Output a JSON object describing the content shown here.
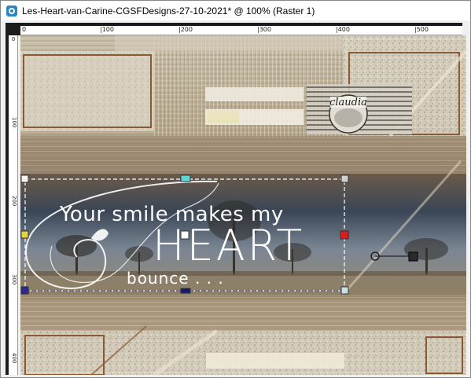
{
  "window": {
    "title": "Les-Heart-van-Carine-CGSFDesigns-27-10-2021* @ 100% (Raster 1)"
  },
  "rulers": {
    "horizontal_labels": [
      "0",
      "|100",
      "|200",
      "|300",
      "|400",
      "|500"
    ],
    "vertical_labels": [
      "0",
      "100",
      "200",
      "300",
      "400"
    ]
  },
  "artwork": {
    "line1": "Your smile makes my",
    "line2": "HEART",
    "line3": "bounce . . .",
    "signature_name": "claudia"
  },
  "colors": {
    "selection_handle": "#ffffff",
    "rotation_handle": "#2a2a2a",
    "frame_brown": "#8a5a35"
  }
}
